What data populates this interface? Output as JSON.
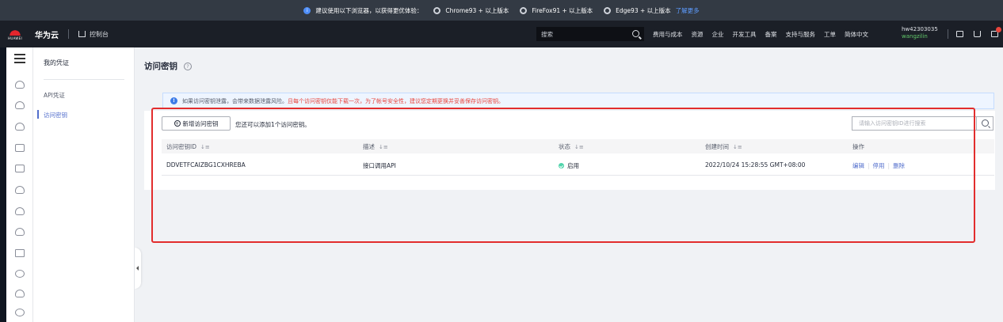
{
  "banner": {
    "message": "建议使用以下浏览器，以获得更优体验：",
    "browsers": [
      "Chrome93 + 以上版本",
      "FireFox91 + 以上版本",
      "Edge93 + 以上版本"
    ],
    "learn_more": "了解更多"
  },
  "header": {
    "logo_text": "HUAWEI",
    "brand": "华为云",
    "console": "控制台",
    "search_placeholder": "搜索",
    "nav": [
      "费用与成本",
      "资源",
      "企业",
      "开发工具",
      "备案",
      "支持与服务",
      "工单",
      "简体中文"
    ],
    "account_id": "hw42303035",
    "username": "wangzilin"
  },
  "sidebar": {
    "title": "我的凭证",
    "items": [
      {
        "label": "API凭证",
        "active": false
      },
      {
        "label": "访问密钥",
        "active": true
      }
    ]
  },
  "main": {
    "title": "访问密钥",
    "alert": {
      "normal": "如果访问密钥泄露，会带来数据泄露风险。",
      "warning": "且每个访问密钥仅能下载一次，为了帐号安全性，建议您定期更换并妥善保存访问密钥。"
    },
    "new_button": "新增访问密钥",
    "quota_text": "您还可以添加1个访问密钥。",
    "search_placeholder": "请输入访问密钥ID进行搜索",
    "columns": [
      "访问密钥ID",
      "描述",
      "状态",
      "创建时间",
      "操作"
    ],
    "rows": [
      {
        "key_id": "DDVETFCAIZBG1CXHREBA",
        "description": "接口调用API",
        "status": "启用",
        "created": "2022/10/24 15:28:55 GMT+08:00",
        "actions": [
          "编辑",
          "停用",
          "删除"
        ]
      }
    ]
  },
  "colors": {
    "accent": "#526ecc",
    "annotation": "#e22d2d",
    "status_enabled": "#50d4ab",
    "header_bg": "#1b1f27"
  }
}
